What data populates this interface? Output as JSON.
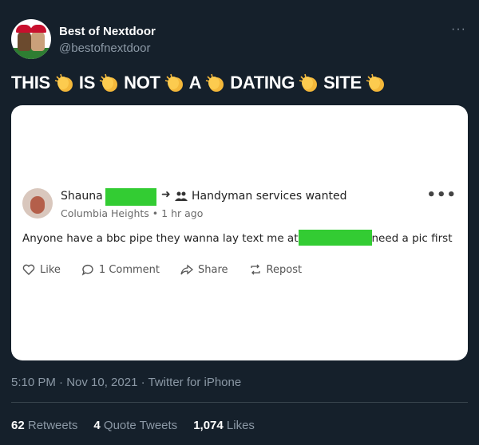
{
  "author": {
    "name": "Best of Nextdoor",
    "handle": "@bestofnextdoor",
    "avatar_icon": "holiday-couple-avatar"
  },
  "more_icon": "ellipsis-icon",
  "tweet": {
    "words": [
      "THIS",
      "IS",
      "NOT",
      "A",
      "DATING",
      "SITE"
    ],
    "emoji": "clapping-hands-emoji"
  },
  "embedded_post": {
    "author": "Shauna",
    "arrow": "➜",
    "group_icon": "people-icon",
    "group": "Handyman services wanted",
    "meta": "Columbia Heights • 1 hr ago",
    "body_before": "Anyone have a bbc pipe they wanna lay text me at",
    "body_after": "need a pic first",
    "more": "•••",
    "actions": {
      "like": "Like",
      "comment": "1 Comment",
      "share": "Share",
      "repost": "Repost"
    },
    "redaction_color": "#33cc33"
  },
  "timestamp": "5:10 PM · Nov 10, 2021 · Twitter for iPhone",
  "stats": {
    "retweets_count": "62",
    "retweets_label": "Retweets",
    "quotes_count": "4",
    "quotes_label": "Quote Tweets",
    "likes_count": "1,074",
    "likes_label": "Likes"
  },
  "colors": {
    "background": "#15202b",
    "secondary_text": "#8b98a5",
    "divider": "#38444d"
  }
}
